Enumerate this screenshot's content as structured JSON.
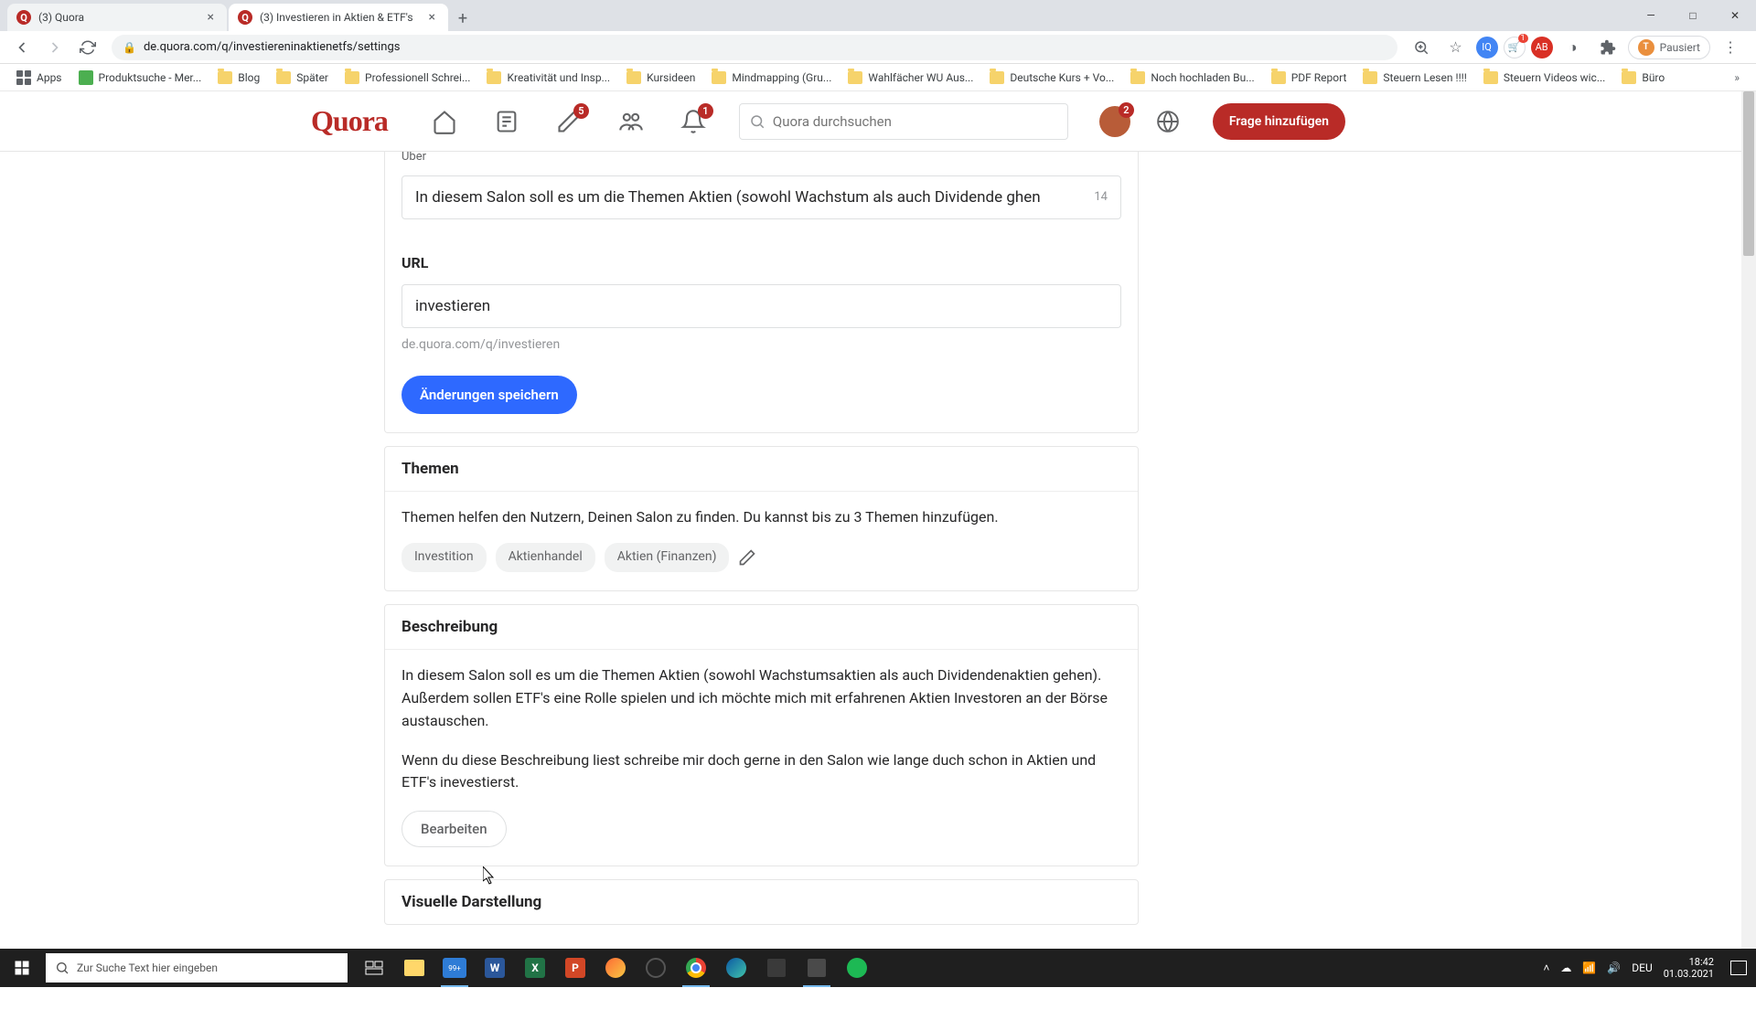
{
  "window": {
    "minimize": "—",
    "maximize": "□",
    "close": "✕"
  },
  "tabs": [
    {
      "title": "(3) Quora",
      "active": false
    },
    {
      "title": "(3) Investieren in Aktien & ETF's",
      "active": true
    }
  ],
  "address_bar": {
    "url": "de.quora.com/q/investiereninaktienetfs/settings",
    "pause_label": "Pausiert"
  },
  "bookmarks": {
    "apps": "Apps",
    "items": [
      "Produktsuche - Mer...",
      "Blog",
      "Später",
      "Professionell Schrei...",
      "Kreativität und Insp...",
      "Kursideen",
      "Mindmapping  (Gru...",
      "Wahlfächer WU Aus...",
      "Deutsche Kurs + Vo...",
      "Noch hochladen Bu...",
      "PDF Report",
      "Steuern Lesen !!!!",
      "Steuern Videos wic...",
      "Büro"
    ]
  },
  "quora_header": {
    "logo": "Quora",
    "search_placeholder": "Quora durchsuchen",
    "ask_button": "Frage hinzufügen",
    "badges": {
      "edit": "5",
      "bell": "1",
      "avatar": "2"
    }
  },
  "settings": {
    "uber_label": "Über",
    "uber_value": "In diesem Salon soll es um die Themen Aktien (sowohl Wachstum als auch Dividende ghen",
    "uber_counter": "14",
    "url_label": "URL",
    "url_value": "investieren",
    "url_helper": "de.quora.com/q/investieren",
    "save_button": "Änderungen speichern",
    "themen_title": "Themen",
    "themen_desc": "Themen helfen den Nutzern, Deinen Salon zu finden. Du kannst bis zu 3 Themen hinzufügen.",
    "themen_tags": [
      "Investition",
      "Aktienhandel",
      "Aktien (Finanzen)"
    ],
    "beschreibung_title": "Beschreibung",
    "beschreibung_p1": "In diesem Salon soll es um die Themen Aktien (sowohl Wachstumsaktien als auch Dividendenaktien gehen). Außerdem sollen ETF's eine Rolle spielen und ich möchte mich mit erfahrenen Aktien Investoren an der Börse austauschen.",
    "beschreibung_p2": "Wenn du diese Beschreibung liest schreibe mir doch gerne in den Salon wie lange duch schon in Aktien und ETF's inevestierst.",
    "edit_button": "Bearbeiten",
    "visuelle_title": "Visuelle Darstellung"
  },
  "taskbar": {
    "search_placeholder": "Zur Suche Text hier eingeben",
    "calendar_badge": "99+",
    "lang": "DEU",
    "time": "18:42",
    "date": "01.03.2021"
  }
}
